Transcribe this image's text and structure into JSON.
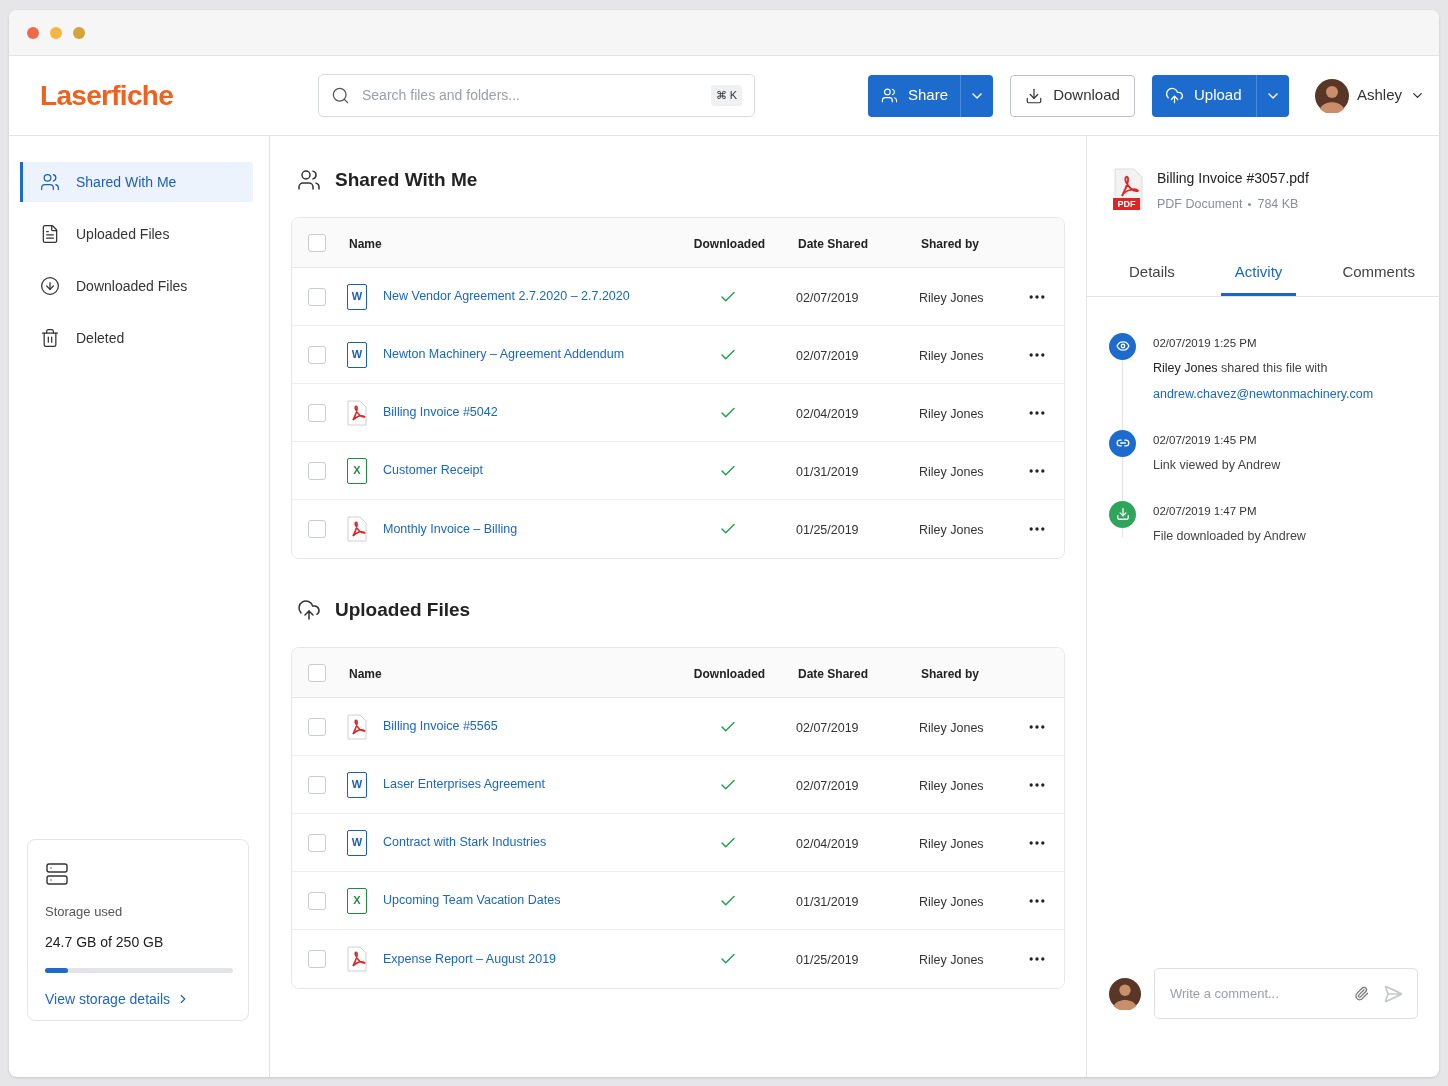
{
  "logo": "Laserfiche",
  "search": {
    "placeholder": "Search files and folders...",
    "shortcut": "⌘ K"
  },
  "actions": [
    {
      "kind": "split",
      "label": "Share"
    },
    {
      "kind": "outline",
      "label": "Download"
    },
    {
      "kind": "split",
      "label": "Upload"
    }
  ],
  "user": {
    "name": "Ashley"
  },
  "sidebar": {
    "items": [
      {
        "label": "Shared With Me",
        "selected": true
      },
      {
        "label": "Uploaded Files",
        "selected": false
      },
      {
        "label": "Downloaded Files",
        "selected": false
      },
      {
        "label": "Deleted",
        "selected": false
      }
    ],
    "storage": {
      "label": "Storage used",
      "value": "24.7 GB of 250 GB",
      "level": 0.12,
      "link": "View storage details"
    }
  },
  "sections": [
    {
      "title": "Shared With Me",
      "all_selected": false,
      "columns": [
        "Name",
        "Downloaded",
        "Date Shared",
        "Shared by"
      ],
      "rows": [
        {
          "name": "New Vendor Agreement 2.7.2020 – 2.7.2020",
          "kind": "word",
          "icon_text": "W",
          "downloaded": true,
          "date": "02/07/2019",
          "shared_by": "Riley Jones",
          "selected": false
        },
        {
          "name": "Newton Machinery – Agreement Addendum",
          "kind": "word",
          "icon_text": "W",
          "downloaded": true,
          "date": "02/07/2019",
          "shared_by": "Riley Jones",
          "selected": false
        },
        {
          "name": "Billing Invoice #5042",
          "kind": "pdf",
          "downloaded": true,
          "date": "02/04/2019",
          "shared_by": "Riley Jones",
          "selected": false
        },
        {
          "name": "Customer Receipt",
          "kind": "excel",
          "icon_text": "X",
          "downloaded": true,
          "date": "01/31/2019",
          "shared_by": "Riley Jones",
          "selected": false
        },
        {
          "name": "Monthly Invoice – Billing",
          "kind": "pdf",
          "downloaded": true,
          "date": "01/25/2019",
          "shared_by": "Riley Jones",
          "selected": false
        }
      ]
    },
    {
      "title": "Uploaded Files",
      "all_selected": false,
      "columns": [
        "Name",
        "Downloaded",
        "Date Shared",
        "Shared by"
      ],
      "rows": [
        {
          "name": "Billing Invoice #5565",
          "kind": "pdf",
          "downloaded": true,
          "date": "02/07/2019",
          "shared_by": "Riley Jones",
          "selected": false
        },
        {
          "name": "Laser Enterprises Agreement",
          "kind": "word",
          "icon_text": "W",
          "downloaded": true,
          "date": "02/07/2019",
          "shared_by": "Riley Jones",
          "selected": false
        },
        {
          "name": "Contract with Stark Industries",
          "kind": "word",
          "icon_text": "W",
          "downloaded": true,
          "date": "02/04/2019",
          "shared_by": "Riley Jones",
          "selected": false
        },
        {
          "name": "Upcoming Team Vacation Dates",
          "kind": "excel",
          "icon_text": "X",
          "downloaded": true,
          "date": "01/31/2019",
          "shared_by": "Riley Jones",
          "selected": false
        },
        {
          "name": "Expense Report – August 2019",
          "kind": "pdf",
          "downloaded": true,
          "date": "01/25/2019",
          "shared_by": "Riley Jones",
          "selected": false
        }
      ]
    }
  ],
  "details": {
    "file_name": "Billing Invoice #3057.pdf",
    "file_type": "PDF Document",
    "file_size": "784 KB",
    "icon_text": "PDF",
    "tabs": [
      {
        "label": "Details",
        "selected": false
      },
      {
        "label": "Activity",
        "selected": true
      },
      {
        "label": "Comments",
        "selected": false
      }
    ],
    "activity": [
      {
        "kind": "view",
        "time": "02/07/2019 1:25 PM",
        "text": "**Riley Jones** shared this file with",
        "link": "andrew.chavez@newtonmachinery.com"
      },
      {
        "kind": "link",
        "time": "02/07/2019 1:45 PM",
        "text": "Link viewed by Andrew"
      },
      {
        "kind": "download",
        "time": "02/07/2019 1:47 PM",
        "text": "File downloaded by Andrew"
      }
    ],
    "comment": {
      "placeholder": "Write a comment..."
    }
  }
}
